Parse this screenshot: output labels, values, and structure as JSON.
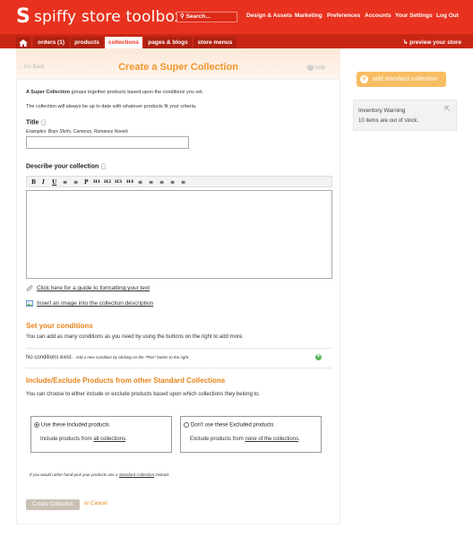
{
  "header": {
    "logo_text": "spiffy store toolbox",
    "search_label": "Search...",
    "nav": [
      "Design & Assets",
      "Marketing",
      "Preferences",
      "Accounts",
      "Your Settings",
      "Log Out"
    ]
  },
  "tabs": [
    "orders (1)",
    "products",
    "collections",
    "pages & blogs",
    "store menus"
  ],
  "active_tab": "collections",
  "preview_label": "preview your store",
  "page": {
    "go_back": "Go Back",
    "title": "Create a Super Collection",
    "help": "help"
  },
  "intro": {
    "line1_bold": "A Super Collection",
    "line1_rest": " groups together products based upon the conditions you set.",
    "line2": "The collection will always be up to date with whatever products fit your criteria."
  },
  "title_field": {
    "label": "Title",
    "examples": "Examples: Boys Shirts, Cameras, Romance Novels",
    "value": ""
  },
  "description": {
    "label": "Describe your collection",
    "toolbar": [
      "B",
      "I",
      "U",
      "≡",
      "≡",
      "P",
      "H1",
      "H2",
      "H3",
      "H4",
      "≡",
      "≡",
      "≡",
      "≡",
      "≡"
    ]
  },
  "links": {
    "format_guide": "Click here for a guide to formatting your text",
    "insert_image": "Insert an image into the collection description"
  },
  "conditions": {
    "title": "Set your conditions",
    "desc": "You can add as many conditions as you need by using the buttons on the right to add more.",
    "empty_bold": "No conditions exist.",
    "empty_hint": "Add a new condition by clicking on the \"Plus\" button to the right."
  },
  "include_exclude": {
    "title": "Include/Exclude Products from other Standard Collections",
    "desc": "You can choose to either include or exclude products based upon which collections they belong to.",
    "include": {
      "label": "Use these Included products",
      "desc_pre": "Include products from ",
      "desc_link": "all collections",
      "desc_post": "."
    },
    "exclude": {
      "label": "Don't use these Excluded products",
      "desc_pre": "Exclude products from ",
      "desc_link": "none of the collections",
      "desc_post": "."
    },
    "selected": "include"
  },
  "footer_note": {
    "pre": "If you would rather hand-pick your products use a ",
    "link": "Standard Collection",
    "post": " instead."
  },
  "actions": {
    "create": "Create Collection",
    "cancel": "or Cancel"
  },
  "sidebar": {
    "add_standard": "add standard collection",
    "warning_title": "Inventory Warning",
    "warning_text": "10 items are out of stock."
  },
  "colors": {
    "brand_red": "#e8321f",
    "accent_orange": "#e8821a",
    "button_orange": "#f8bd62"
  }
}
